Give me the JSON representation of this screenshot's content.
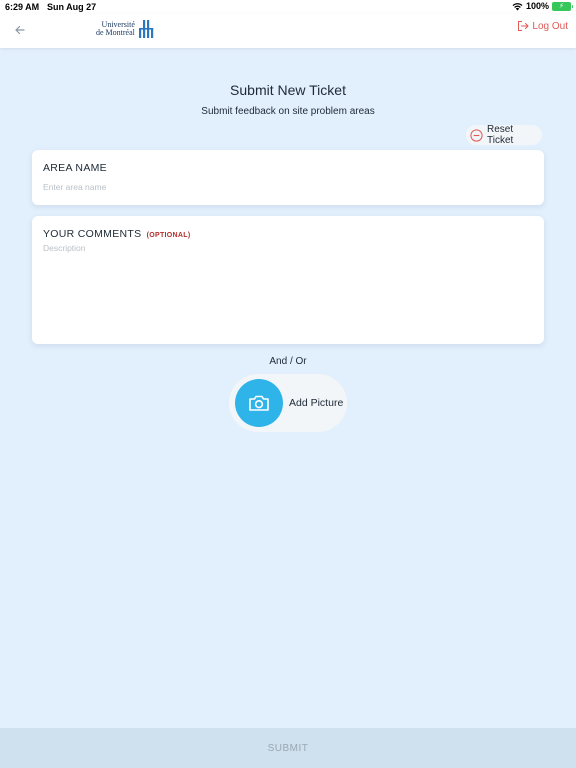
{
  "status": {
    "time": "6:29 AM",
    "date": "Sun Aug 27",
    "battery": "100%"
  },
  "header": {
    "logo_line1": "Université",
    "logo_line2": "de Montréal",
    "logout_label": "Log Out"
  },
  "page": {
    "title": "Submit New Ticket",
    "subtitle": "Submit feedback on site problem areas",
    "reset_label": "Reset Ticket"
  },
  "form": {
    "area_label": "AREA NAME",
    "area_placeholder": "Enter area name",
    "area_value": "",
    "comments_label": "YOUR COMMENTS",
    "comments_optional": "(OPTIONAL)",
    "comments_placeholder": "Description",
    "comments_value": "",
    "and_or": "And / Or",
    "add_picture_label": "Add Picture"
  },
  "footer": {
    "submit_label": "SUBMIT"
  },
  "colors": {
    "background": "#e2effc",
    "accent_camera": "#2fb4e9",
    "logout": "#e05a55",
    "optional": "#b0302d",
    "submit_bg": "#cfe0ef"
  },
  "icons": [
    "back-arrow-icon",
    "logout-icon",
    "minus-circle-icon",
    "camera-icon",
    "wifi-icon",
    "battery-icon"
  ]
}
